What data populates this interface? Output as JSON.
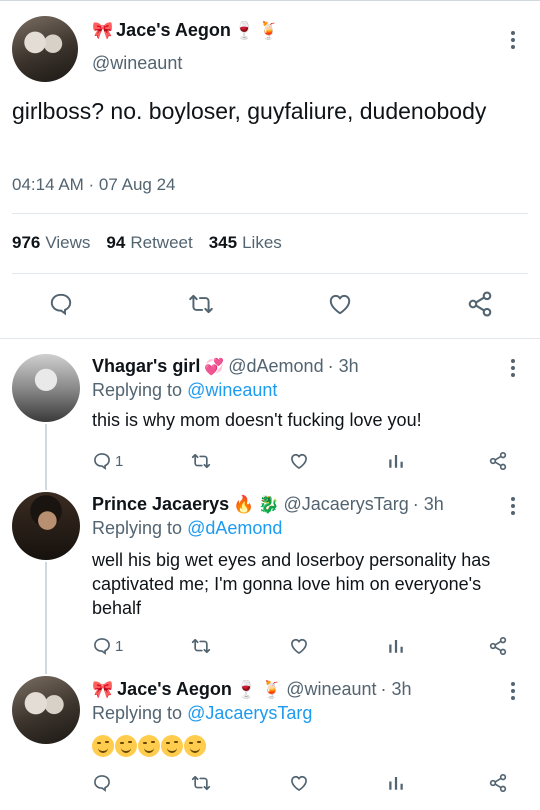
{
  "main_tweet": {
    "display_name": "Jace's Aegon",
    "handle": "@wineaunt",
    "text": "girlboss? no. boyloser, guyfaliure, dudenobody",
    "timestamp": "04:14 AM · 07 Aug 24",
    "stats": {
      "views_count": "976",
      "views_label": "Views",
      "retweets_count": "94",
      "retweets_label": "Retweet",
      "likes_count": "345",
      "likes_label": "Likes"
    }
  },
  "replies": [
    {
      "display_name": "Vhagar's girl",
      "handle": "@dAemond",
      "time": "· 3h",
      "replying_prefix": "Replying to",
      "replying_to": "@wineaunt",
      "text": "this is why mom doesn't fucking love you!",
      "reply_count": "1"
    },
    {
      "display_name": "Prince Jacaerys",
      "handle": "@JacaerysTarg",
      "time": "· 3h",
      "replying_prefix": "Replying to",
      "replying_to": "@dAemond",
      "text": "well his big wet eyes and loserboy personality has captivated me; I'm gonna love him on everyone's behalf",
      "reply_count": "1"
    },
    {
      "display_name": "Jace's Aegon",
      "handle": "@wineaunt",
      "time": "· 3h",
      "replying_prefix": "Replying to",
      "replying_to": "@JacaerysTarg",
      "text": "",
      "emoji_count": 5
    }
  ],
  "colors": {
    "accent": "#1d9bf0",
    "secondary_text": "#536471",
    "primary_text": "#0f1419",
    "divider": "#e1e8ed"
  },
  "icons": [
    "more-icon",
    "reply-icon",
    "retweet-icon",
    "like-icon",
    "share-icon",
    "views-icon"
  ]
}
